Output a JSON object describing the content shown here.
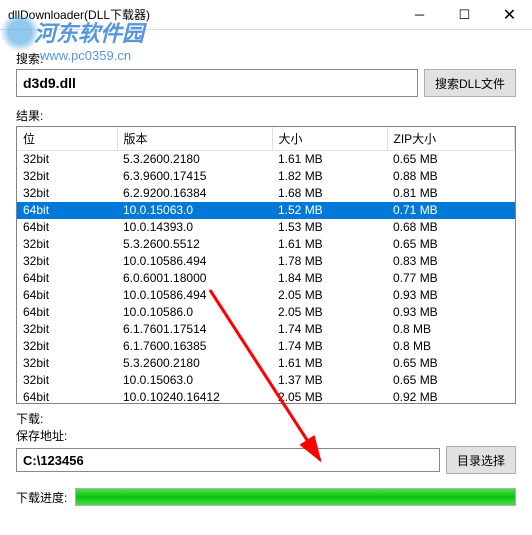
{
  "window": {
    "title": "dllDownloader(DLL下载器)"
  },
  "watermark": {
    "text": "河东软件园",
    "url": "www.pc0359.cn"
  },
  "search": {
    "label": "搜索:",
    "value": "d3d9.dll",
    "button": "搜索DLL文件"
  },
  "results": {
    "label": "结果:",
    "headers": {
      "bit": "位",
      "version": "版本",
      "size": "大小",
      "zipsize": "ZIP大小"
    },
    "rows": [
      {
        "bit": "32bit",
        "ver": "5.3.2600.2180",
        "size": "1.61 MB",
        "zip": "0.65 MB",
        "sel": false
      },
      {
        "bit": "32bit",
        "ver": "6.3.9600.17415",
        "size": "1.82 MB",
        "zip": "0.88 MB",
        "sel": false
      },
      {
        "bit": "32bit",
        "ver": "6.2.9200.16384",
        "size": "1.68 MB",
        "zip": "0.81 MB",
        "sel": false
      },
      {
        "bit": "64bit",
        "ver": "10.0.15063.0",
        "size": "1.52 MB",
        "zip": "0.71 MB",
        "sel": true
      },
      {
        "bit": "64bit",
        "ver": "10.0.14393.0",
        "size": "1.53 MB",
        "zip": "0.68 MB",
        "sel": false
      },
      {
        "bit": "32bit",
        "ver": "5.3.2600.5512",
        "size": "1.61 MB",
        "zip": "0.65 MB",
        "sel": false
      },
      {
        "bit": "32bit",
        "ver": "10.0.10586.494",
        "size": "1.78 MB",
        "zip": "0.83 MB",
        "sel": false
      },
      {
        "bit": "64bit",
        "ver": "6.0.6001.18000",
        "size": "1.84 MB",
        "zip": "0.77 MB",
        "sel": false
      },
      {
        "bit": "64bit",
        "ver": "10.0.10586.494",
        "size": "2.05 MB",
        "zip": "0.93 MB",
        "sel": false
      },
      {
        "bit": "64bit",
        "ver": "10.0.10586.0",
        "size": "2.05 MB",
        "zip": "0.93 MB",
        "sel": false
      },
      {
        "bit": "32bit",
        "ver": "6.1.7601.17514",
        "size": "1.74 MB",
        "zip": "0.8 MB",
        "sel": false
      },
      {
        "bit": "32bit",
        "ver": "6.1.7600.16385",
        "size": "1.74 MB",
        "zip": "0.8 MB",
        "sel": false
      },
      {
        "bit": "32bit",
        "ver": "5.3.2600.2180",
        "size": "1.61 MB",
        "zip": "0.65 MB",
        "sel": false
      },
      {
        "bit": "32bit",
        "ver": "10.0.15063.0",
        "size": "1.37 MB",
        "zip": "0.65 MB",
        "sel": false
      },
      {
        "bit": "64bit",
        "ver": "10.0.10240.16412",
        "size": "2.05 MB",
        "zip": "0.92 MB",
        "sel": false
      }
    ]
  },
  "download": {
    "label": "下载:",
    "pathLabel": "保存地址:",
    "path": "C:\\123456",
    "browseBtn": "目录选择"
  },
  "progress": {
    "label": "下载进度:",
    "percent": 100
  }
}
